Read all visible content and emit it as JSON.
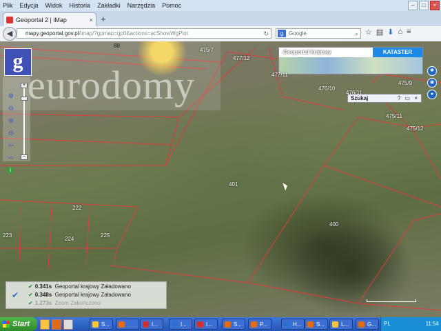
{
  "menu": {
    "items": [
      "Plik",
      "Edycja",
      "Widok",
      "Historia",
      "Zakładki",
      "Narzędzia",
      "Pomoc"
    ]
  },
  "browser": {
    "tab_title": "Geoportal 2 | iMap",
    "url_host": "mapy.geoportal.gov.pl",
    "url_path": "/imap/?gpmap=gp0&actions=acShowWgPlot",
    "search_placeholder": "Google",
    "search_engine_icon": "google-icon"
  },
  "map": {
    "logo_letter": "g",
    "watermark": "eurodomy",
    "gk_title": "Geoportal krajowy",
    "kataster_label": "KATASTER",
    "szukaj_label": "Szukaj",
    "scalebar_label": "",
    "parcels": [
      "88",
      "475/7",
      "477/12",
      "475/9",
      "477/11",
      "476/10",
      "476/11",
      "475/11",
      "475/12",
      "401",
      "400",
      "222",
      "223",
      "224",
      "225"
    ],
    "status_rows": [
      {
        "time": "0.341s",
        "text": "Geoportal krajowy  Załadowano",
        "ok": true
      },
      {
        "time": "0.348s",
        "text": "Geoportal krajowy  Załadowano",
        "ok": true
      },
      {
        "time": "1.273s",
        "text": "Zoom  Zakończono",
        "ok": true
      }
    ]
  },
  "taskbar": {
    "start_label": "Start",
    "buttons": [
      {
        "label": "S...",
        "color": "#f5c542"
      },
      {
        "label": "",
        "color": "#e06c1a"
      },
      {
        "label": "I...",
        "color": "#d32f2f"
      },
      {
        "label": "I...",
        "color": "#2b6fd0"
      },
      {
        "label": "I...",
        "color": "#d32f2f"
      },
      {
        "label": "S...",
        "color": "#e06c1a"
      },
      {
        "label": "P...",
        "color": "#e06c1a"
      },
      {
        "label": "H...",
        "color": "#2b6fd0"
      },
      {
        "label": "S...",
        "color": "#e06c1a"
      },
      {
        "label": "L...",
        "color": "#f5c542"
      },
      {
        "label": "G...",
        "color": "#e06c1a"
      }
    ],
    "lang": "PL",
    "clock": "11:54"
  }
}
